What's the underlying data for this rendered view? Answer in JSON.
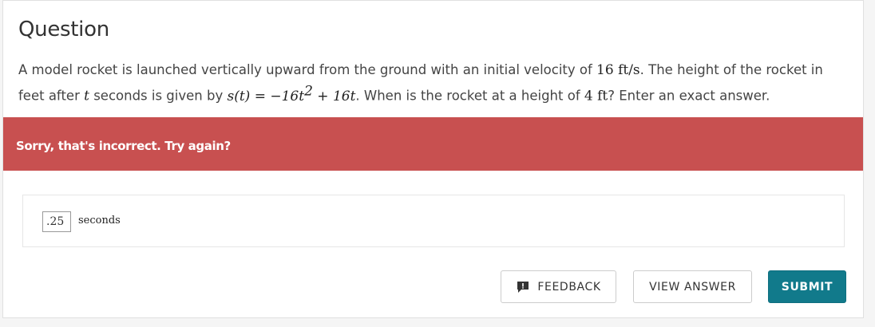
{
  "question": {
    "title": "Question",
    "text_part1": "A model rocket is launched vertically upward from the ground with an initial velocity of ",
    "math_velocity": "16 ft/s",
    "text_part2": ". The height of the rocket in feet after ",
    "math_t": "t",
    "text_part3": " seconds is given by ",
    "math_func": "s(t) = −16t",
    "math_exp": "2",
    "math_func_tail": " + 16t",
    "text_part4": ". When is the rocket at a height of ",
    "math_height": "4 ft",
    "text_part5": "? Enter an exact answer."
  },
  "feedback_banner": {
    "message": "Sorry, that's incorrect. Try again?",
    "color": "#c85050"
  },
  "answer": {
    "value": ".25",
    "unit": "seconds"
  },
  "buttons": {
    "feedback_label": "FEEDBACK",
    "feedback_icon": "speech-bubble-exclamation-icon",
    "view_answer_label": "VIEW ANSWER",
    "submit_label": "SUBMIT",
    "submit_color": "#117a8b"
  }
}
